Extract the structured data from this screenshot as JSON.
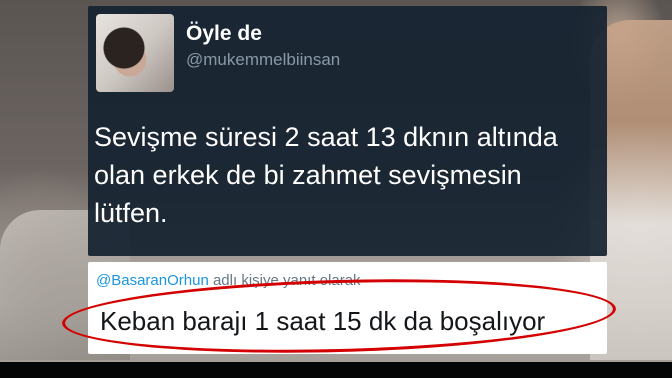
{
  "tweet": {
    "display_name": "Öyle de",
    "handle": "@mukemmelbiinsan",
    "text_lines": [
      "Sevişme süresi 2 saat 13 dknın altında",
      "olan erkek de bi zahmet sevişmesin",
      "lütfen."
    ]
  },
  "reply": {
    "mention": "@BasaranOrhun",
    "context_suffix": " adlı kişiye yanıt olarak",
    "text": "Keban barajı 1 saat 15 dk da boşalıyor"
  },
  "colors": {
    "tweet_bg": "#162230",
    "handle": "#8899a6",
    "mention": "#1b95e0",
    "highlight_oval": "#d40000"
  }
}
